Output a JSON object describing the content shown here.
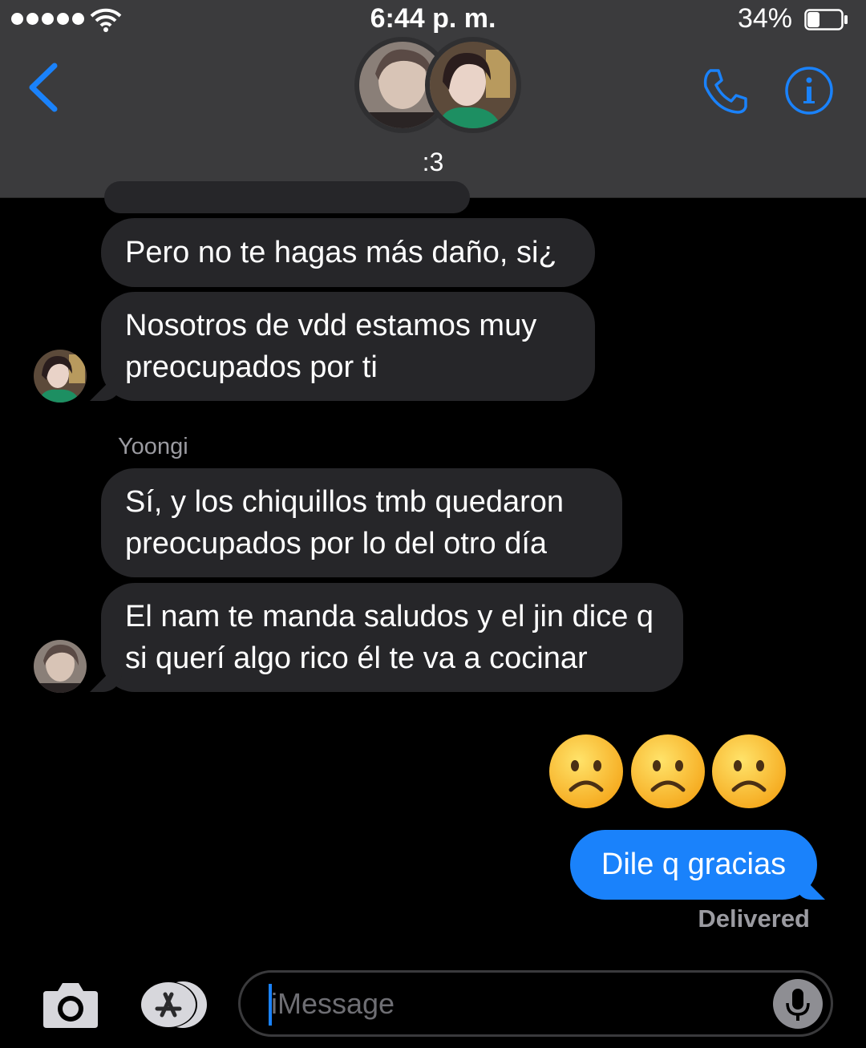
{
  "status_bar": {
    "time": "6:44 p. m.",
    "battery": "34%",
    "battery_level": 0.34
  },
  "header": {
    "conversation_title": ":3"
  },
  "messages": [
    {
      "text": "Pero no te hagas más daño, si¿"
    },
    {
      "text": "Nosotros de vdd estamos muy preocupados por ti"
    },
    {
      "sender": "Yoongi",
      "text": "Sí, y los chiquillos tmb quedaron preocupados por lo del otro día"
    },
    {
      "text": "El nam te manda saludos y el jin dice q si querí algo rico él te va a cocinar"
    }
  ],
  "sent": {
    "emojis": "☹️☹️☹️",
    "text": "Dile q gracias",
    "status": "Delivered"
  },
  "input": {
    "placeholder": "iMessage"
  },
  "colors": {
    "accent": "#1a82fb",
    "incoming_bubble": "#262629",
    "header_bg": "#3b3b3d"
  }
}
